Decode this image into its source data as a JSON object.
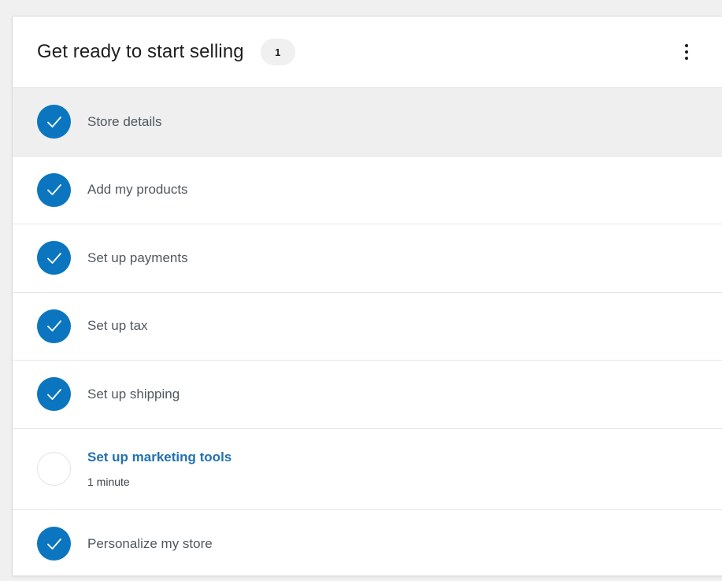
{
  "header": {
    "title": "Get ready to start selling",
    "badge_count": "1",
    "menu_icon": "ellipsis-vertical-icon"
  },
  "tasks": [
    {
      "label": "Store details",
      "completed": true
    },
    {
      "label": "Add my products",
      "completed": true
    },
    {
      "label": "Set up payments",
      "completed": true
    },
    {
      "label": "Set up tax",
      "completed": true
    },
    {
      "label": "Set up shipping",
      "completed": true
    },
    {
      "label": "Set up marketing tools",
      "completed": false,
      "time": "1 minute"
    },
    {
      "label": "Personalize my store",
      "completed": true
    }
  ],
  "colors": {
    "check_bg": "#0b76bf",
    "active_link": "#2271b1",
    "hover_row": "#efefef"
  }
}
